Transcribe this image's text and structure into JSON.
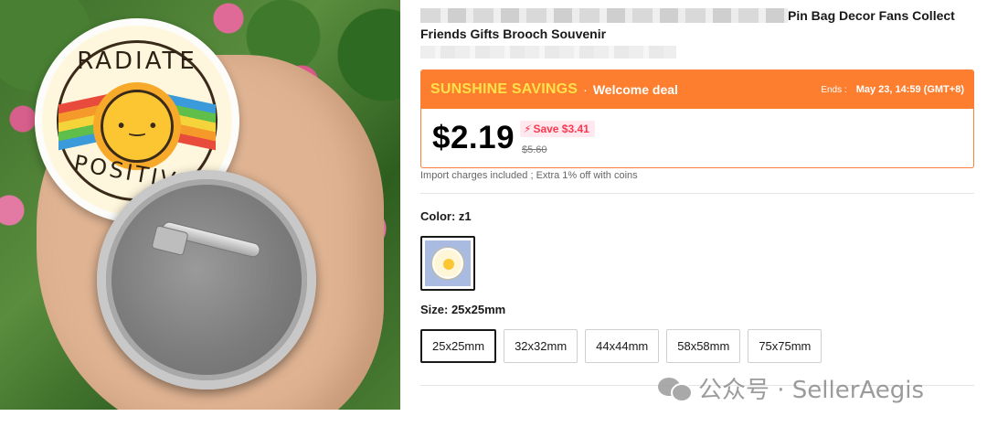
{
  "product": {
    "title_visible": "Pin Bag Decor Fans Collect",
    "title_line2": "Friends Gifts Brooch Souvenir"
  },
  "image_badge": {
    "top_word": "RADIATE",
    "bottom_word": "POSITIVITY",
    "face": "• ‿ •"
  },
  "deal": {
    "name": "SUNSHINE SAVINGS",
    "separator": "·",
    "type": "Welcome deal",
    "ends_label": "Ends :",
    "ends_value": "May 23, 14:59 (GMT+8)",
    "price": "$2.19",
    "save_icon": "bolt-icon",
    "save_text": "Save $3.41",
    "original_price": "$5.60",
    "accent_color": "#fd7e2f",
    "deal_name_color": "#ffe14a",
    "save_color": "#fd384f"
  },
  "import_note": "Import charges included ; Extra 1% off with coins",
  "color_option": {
    "label": "Color: z1",
    "selected": "z1"
  },
  "size_option": {
    "label": "Size: 25x25mm",
    "options": [
      "25x25mm",
      "32x32mm",
      "44x44mm",
      "58x58mm",
      "75x75mm"
    ],
    "selected": "25x25mm"
  },
  "watermark": {
    "text": "公众号 · SellerAegis",
    "icon": "wechat-icon"
  }
}
